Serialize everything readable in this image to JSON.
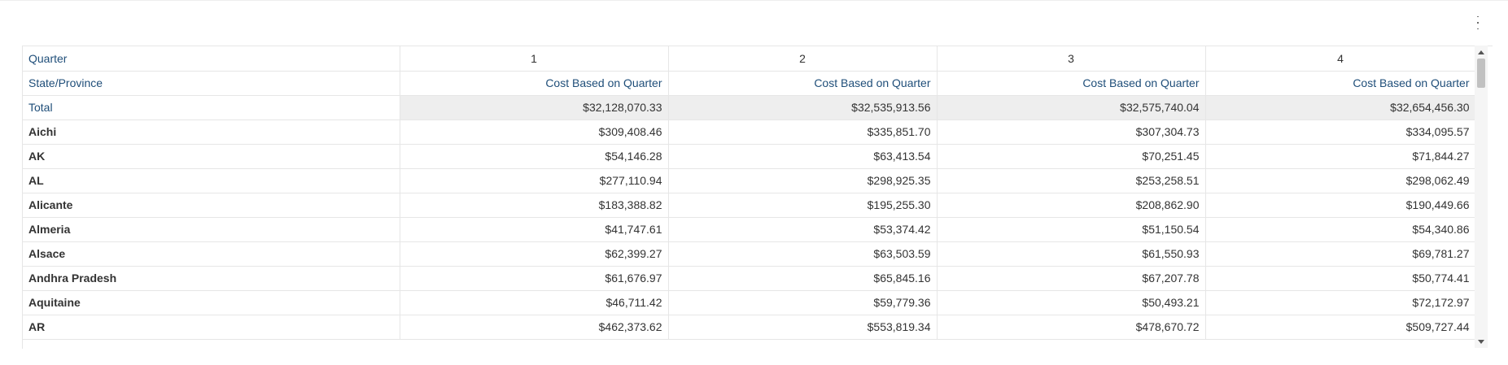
{
  "toolbar": {
    "menu_icon": "kebab-menu-icon"
  },
  "table": {
    "header_row1": {
      "label": "Quarter",
      "columns": [
        "1",
        "2",
        "3",
        "4"
      ]
    },
    "header_row2": {
      "label": "State/Province",
      "columns": [
        "Cost Based on Quarter",
        "Cost Based on Quarter",
        "Cost Based on Quarter",
        "Cost Based on Quarter"
      ]
    },
    "total": {
      "label": "Total",
      "values": [
        "$32,128,070.33",
        "$32,535,913.56",
        "$32,575,740.04",
        "$32,654,456.30"
      ]
    },
    "rows": [
      {
        "label": "Aichi",
        "values": [
          "$309,408.46",
          "$335,851.70",
          "$307,304.73",
          "$334,095.57"
        ]
      },
      {
        "label": "AK",
        "values": [
          "$54,146.28",
          "$63,413.54",
          "$70,251.45",
          "$71,844.27"
        ]
      },
      {
        "label": "AL",
        "values": [
          "$277,110.94",
          "$298,925.35",
          "$253,258.51",
          "$298,062.49"
        ]
      },
      {
        "label": "Alicante",
        "values": [
          "$183,388.82",
          "$195,255.30",
          "$208,862.90",
          "$190,449.66"
        ]
      },
      {
        "label": "Almeria",
        "values": [
          "$41,747.61",
          "$53,374.42",
          "$51,150.54",
          "$54,340.86"
        ]
      },
      {
        "label": "Alsace",
        "values": [
          "$62,399.27",
          "$63,503.59",
          "$61,550.93",
          "$69,781.27"
        ]
      },
      {
        "label": "Andhra Pradesh",
        "values": [
          "$61,676.97",
          "$65,845.16",
          "$67,207.78",
          "$50,774.41"
        ]
      },
      {
        "label": "Aquitaine",
        "values": [
          "$46,711.42",
          "$59,779.36",
          "$50,493.21",
          "$72,172.97"
        ]
      },
      {
        "label": "AR",
        "values": [
          "$462,373.62",
          "$553,819.34",
          "$478,670.72",
          "$509,727.44"
        ]
      }
    ]
  },
  "colors": {
    "label_blue": "#1f4e79",
    "total_bg": "#eeeeee",
    "border": "#e6e6e6"
  }
}
